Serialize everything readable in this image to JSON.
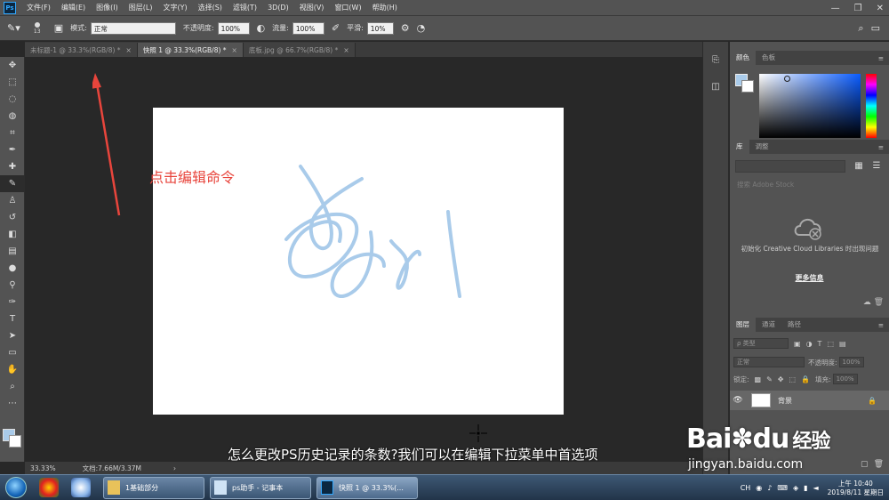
{
  "menubar": {
    "logo": "Ps",
    "items": [
      "文件(F)",
      "编辑(E)",
      "图像(I)",
      "图层(L)",
      "文字(Y)",
      "选择(S)",
      "滤镜(T)",
      "3D(D)",
      "视图(V)",
      "窗口(W)",
      "帮助(H)"
    ],
    "controls": [
      "—",
      "❐",
      "✕"
    ]
  },
  "options": {
    "brush_size": "13",
    "mode_label": "模式:",
    "mode_value": "正常",
    "opacity_label": "不透明度:",
    "opacity_value": "100%",
    "flow_label": "流量:",
    "flow_value": "100%",
    "smoothing_label": "平滑:",
    "smoothing_value": "10%"
  },
  "tabs": [
    {
      "label": "未标题-1 @ 33.3%(RGB/8) *",
      "close": "×"
    },
    {
      "label": "快照 1 @ 33.3%(RGB/8) *",
      "close": "×"
    },
    {
      "label": "底板.jpg @ 66.7%(RGB/8) *",
      "close": "×"
    }
  ],
  "annotation": "点击编辑命令",
  "subtitle": "怎么更改PS历史记录的条数?我们可以在编辑下拉菜单中首选项",
  "status": {
    "zoom": "33.33%",
    "doc": "文档:7.66M/3.37M",
    "arrow": "›"
  },
  "panels": {
    "color_tabs": [
      "颜色",
      "色板"
    ],
    "library_tabs": [
      "库",
      "调整"
    ],
    "library_search_placeholder": "搜索 Adobe Stock",
    "library_message": "初始化 Creative Cloud Libraries 时出现问题",
    "library_more": "更多信息",
    "layers_tabs": [
      "图层",
      "通道",
      "路径"
    ],
    "layers_filter": "ρ 类型",
    "blend_mode": "正常",
    "opacity_label": "不透明度:",
    "opacity_value": "100%",
    "lock_label": "锁定:",
    "fill_label": "填充:",
    "fill_value": "100%",
    "layer_name": "背景"
  },
  "watermark": {
    "logo": "Bai",
    "logo2": "du",
    "cn": "经验",
    "url": "jingyan.baidu.com"
  },
  "taskbar": {
    "buttons": [
      "1基础部分",
      "ps助手 - 记事本",
      "快照 1 @ 33.3%(..."
    ],
    "tray_lang": "CH",
    "clock_time": "上午 10:40",
    "clock_date": "2019/8/11 星期日"
  },
  "colors": {
    "foreground": "#a9cbea",
    "stroke": "#a9cbea",
    "annotation": "#e8453c"
  }
}
